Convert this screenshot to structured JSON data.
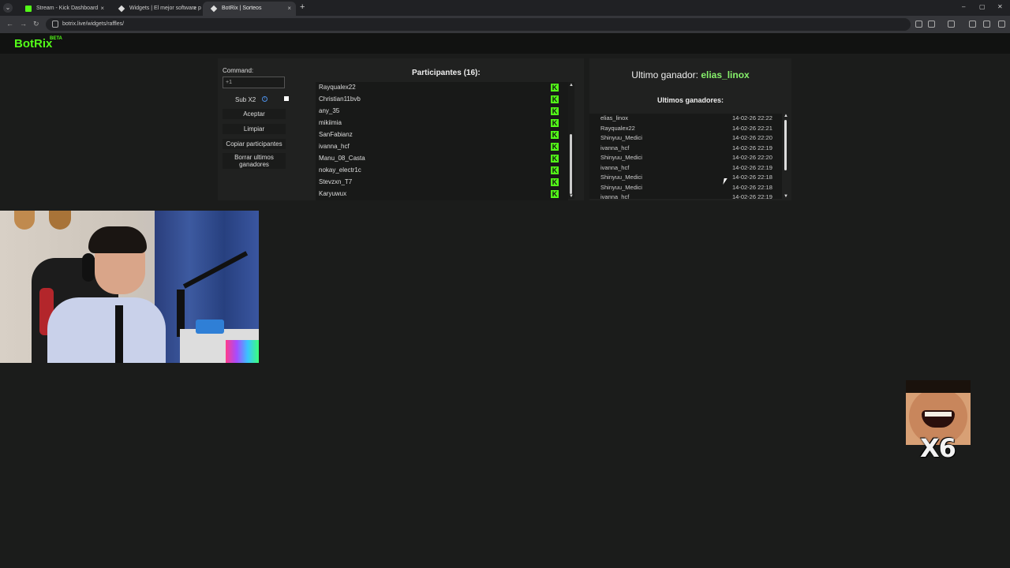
{
  "browser": {
    "tabs": [
      {
        "title": "Stream - Kick Dashboard",
        "icon": "kick-icon",
        "active": false
      },
      {
        "title": "Widgets | El mejor software pa",
        "icon": "botrix-icon",
        "active": false
      },
      {
        "title": "BotRix | Sorteos",
        "icon": "botrix-icon",
        "active": true
      }
    ],
    "new_tab": "+",
    "url": "botrix.live/widgets/raffles/",
    "close_glyph": "×",
    "menu_glyph": "⌄",
    "nav": {
      "back": "←",
      "forward": "→",
      "reload": "↻"
    },
    "window": {
      "minimize": "–",
      "maximize": "▢",
      "close": "✕"
    }
  },
  "site": {
    "logo": "BotRix",
    "badge": "BETA"
  },
  "raffle": {
    "command_label": "Command:",
    "command_value": "+1",
    "sub_label": "Sub X2",
    "info_glyph": "i",
    "buttons": {
      "accept": "Aceptar",
      "clear": "Limpiar",
      "copy": "Copiar participantes",
      "delete_winners": "Borrar ultimos ganadores"
    },
    "participants_title": "Participantes (16):",
    "participants": [
      "Rayqualex22",
      "Christian11bvb",
      "any_35",
      "mikiimia",
      "SanFabianz",
      "ivanna_hcf",
      "Manu_08_Casta",
      "nokay_electr1c",
      "Stevzxn_T7",
      "Karyuwux"
    ],
    "platform_glyph": "K",
    "scroll_up": "▲",
    "scroll_down": "▼"
  },
  "winners": {
    "last_winner_label": "Ultimo ganador:",
    "last_winner_name": "elias_linox",
    "list_title": "Ultimos ganadores:",
    "list": [
      {
        "name": "elias_linox",
        "date": "14-02-26 22:22"
      },
      {
        "name": "Rayqualex22",
        "date": "14-02-26 22:21"
      },
      {
        "name": "Shinyuu_Medici",
        "date": "14-02-26 22:20"
      },
      {
        "name": "ivanna_hcf",
        "date": "14-02-26 22:19"
      },
      {
        "name": "Shinyuu_Medici",
        "date": "14-02-26 22:20"
      },
      {
        "name": "ivanna_hcf",
        "date": "14-02-26 22:19"
      },
      {
        "name": "Shinyuu_Medici",
        "date": "14-02-26 22:18"
      },
      {
        "name": "Shinyuu_Medici",
        "date": "14-02-26 22:18"
      },
      {
        "name": "ivanna_hcf",
        "date": "14-02-26 22:19"
      }
    ],
    "scroll_up": "▲",
    "scroll_down": "▼"
  },
  "overlay": {
    "multiplier": "X6"
  },
  "colors": {
    "brand": "#53fc18",
    "winner": "#86f06b",
    "background": "#1b1c1b",
    "panel": "#202120"
  }
}
